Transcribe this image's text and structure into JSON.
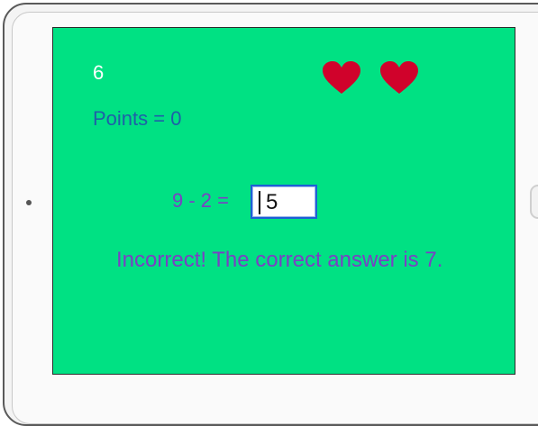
{
  "game": {
    "timer": "6",
    "points_label": "Points = ",
    "points_value": "0",
    "lives": 2,
    "heart_color": "#d0022b",
    "background_color": "#00e183",
    "equation": "9 - 2 =",
    "answer_value": "5",
    "feedback": "Incorrect! The correct answer is 7."
  },
  "icons": {
    "heart": "heart-icon"
  }
}
